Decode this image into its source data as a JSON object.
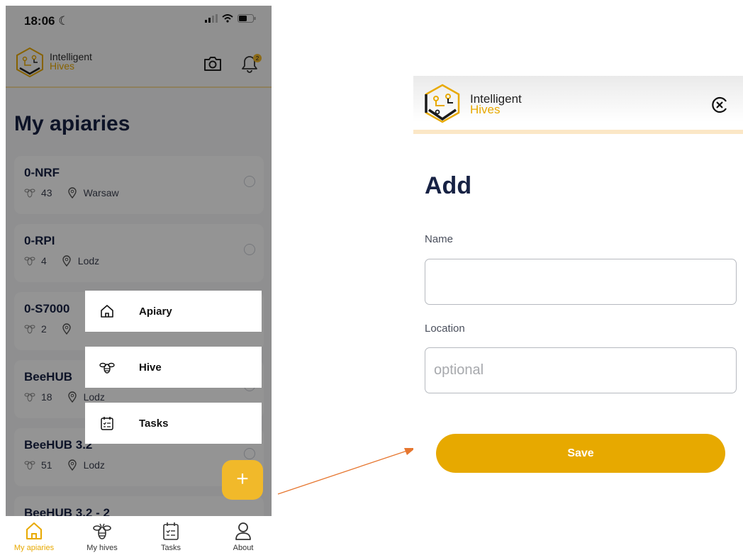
{
  "phone": {
    "status_time": "18:06",
    "header": {
      "brand_line1": "Intelligent",
      "brand_line2": "Hives",
      "notification_count": "2"
    },
    "title": "My apiaries",
    "apiaries": [
      {
        "name": "0-NRF",
        "hives": "43",
        "location": "Warsaw"
      },
      {
        "name": "0-RPI",
        "hives": "4",
        "location": "Lodz"
      },
      {
        "name": "0-S7000",
        "hives": "2",
        "location": ""
      },
      {
        "name": "BeeHUB",
        "hives": "18",
        "location": "Lodz"
      },
      {
        "name": "BeeHUB 3.2",
        "hives": "51",
        "location": "Lodz"
      },
      {
        "name": "BeeHUB 3.2 - 2",
        "hives": "",
        "location": ""
      }
    ],
    "add_menu": [
      {
        "label": "Apiary",
        "icon": "home-icon"
      },
      {
        "label": "Hive",
        "icon": "bee-icon"
      },
      {
        "label": "Tasks",
        "icon": "calendar-icon"
      }
    ],
    "fab_label": "+",
    "tabs": [
      {
        "label": "My apiaries",
        "icon": "home-icon",
        "active": true
      },
      {
        "label": "My hives",
        "icon": "bee-icon",
        "active": false
      },
      {
        "label": "Tasks",
        "icon": "calendar-icon",
        "active": false
      },
      {
        "label": "About",
        "icon": "user-icon",
        "active": false
      }
    ]
  },
  "form": {
    "brand_line1": "Intelligent",
    "brand_line2": "Hives",
    "title": "Add",
    "name_label": "Name",
    "name_value": "",
    "location_label": "Location",
    "location_placeholder": "optional",
    "save_label": "Save"
  },
  "colors": {
    "accent": "#e8a900",
    "title": "#172244",
    "fab": "#f1b92a",
    "arrow": "#e6762f"
  }
}
